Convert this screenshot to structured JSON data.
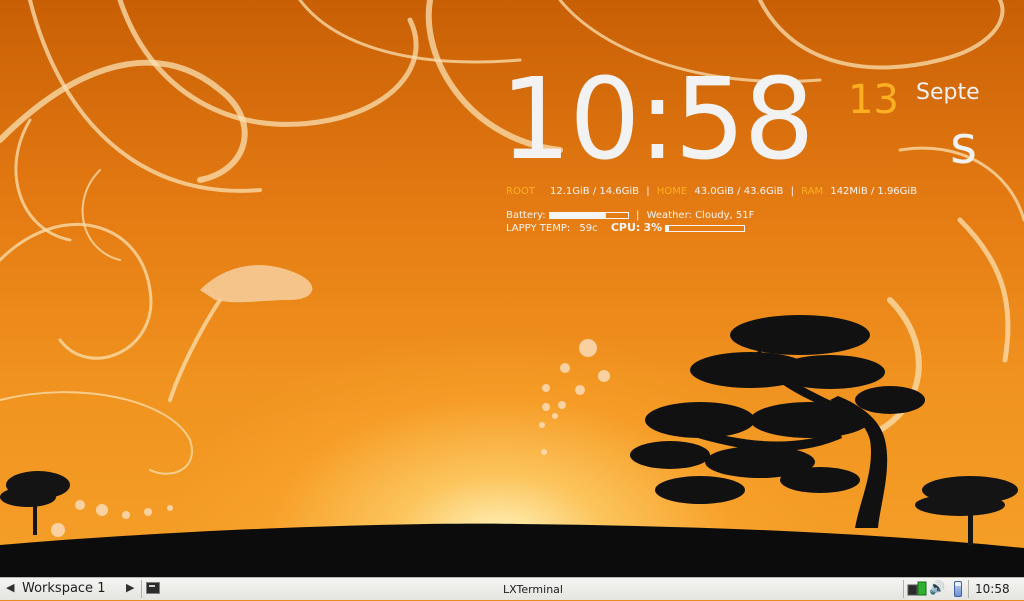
{
  "conky": {
    "time": "10:58",
    "day": "13",
    "month_top": "Septe",
    "month_bottom": "s",
    "root_label": "ROOT",
    "root_value": "12.1GiB / 14.6GiB",
    "home_label": "HOME",
    "home_value": "43.0GiB / 43.6GiB",
    "ram_label": "RAM",
    "ram_value": "142MiB / 1.96GiB",
    "separator": "|",
    "battery_label": "Battery:",
    "battery_level": 0.72,
    "weather_text": "Weather: Cloudy, 51F",
    "temp_label": "LAPPY TEMP:",
    "temp_value": "59c",
    "cpu_label": "CPU:",
    "cpu_value": "3%",
    "cpu_level": 0.03
  },
  "taskbar": {
    "prev_arrow": "◀",
    "workspace": "Workspace 1",
    "next_arrow": "▶",
    "task_title": "LXTerminal",
    "volume_glyph": "🔊",
    "clock": "10:58"
  },
  "colors": {
    "accent": "#ffb020",
    "text": "#f2f2f2",
    "sky_top": "#c85f05",
    "sky_bottom": "#f5a028",
    "taskbar": "#ececea"
  },
  "icons": [
    "terminal-icon",
    "network-icon",
    "volume-icon",
    "battery-icon"
  ]
}
